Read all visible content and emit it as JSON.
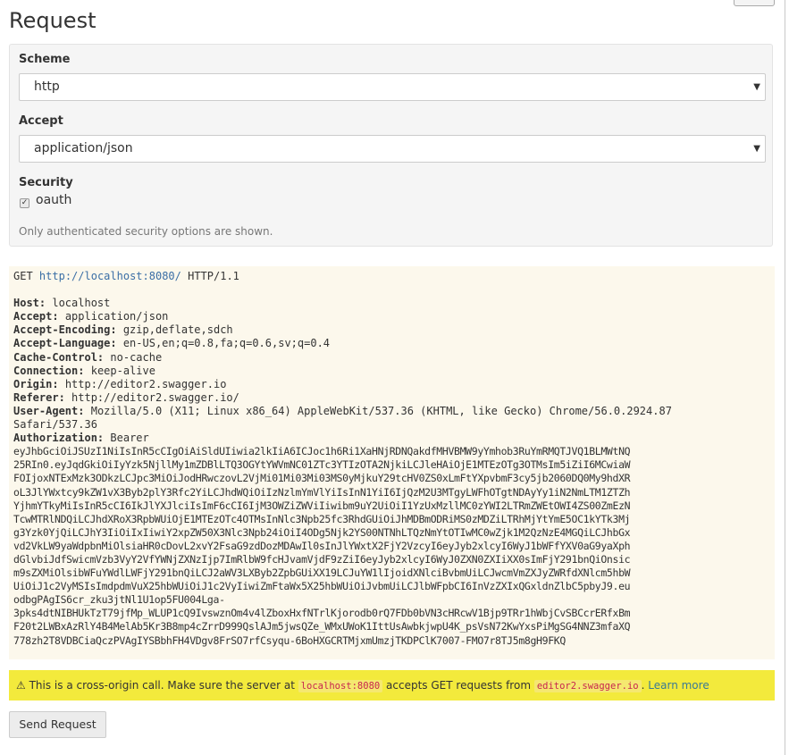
{
  "title": "Request",
  "scheme": {
    "label": "Scheme",
    "value": "http"
  },
  "accept": {
    "label": "Accept",
    "value": "application/json"
  },
  "security": {
    "label": "Security",
    "option": "oauth",
    "checked": true,
    "help": "Only authenticated security options are shown."
  },
  "request": {
    "method": "GET",
    "url": "http://localhost:8080/",
    "protocol": "HTTP/1.1",
    "headers": [
      {
        "name": "Host:",
        "value": "localhost"
      },
      {
        "name": "Accept:",
        "value": "application/json"
      },
      {
        "name": "Accept-Encoding:",
        "value": "gzip,deflate,sdch"
      },
      {
        "name": "Accept-Language:",
        "value": "en-US,en;q=0.8,fa;q=0.6,sv;q=0.4"
      },
      {
        "name": "Cache-Control:",
        "value": "no-cache"
      },
      {
        "name": "Connection:",
        "value": "keep-alive"
      },
      {
        "name": "Origin:",
        "value": "http://editor2.swagger.io"
      },
      {
        "name": "Referer:",
        "value": "http://editor2.swagger.io/"
      }
    ],
    "user_agent_name": "User-Agent:",
    "user_agent_line1": "Mozilla/5.0 (X11; Linux x86_64) AppleWebKit/537.36 (KHTML, like Gecko) Chrome/56.0.2924.87",
    "user_agent_line2": "Safari/537.36",
    "authorization_name": "Authorization:",
    "authorization_value": "Bearer",
    "token_lines": [
      "eyJhbGciOiJSUzI1NiIsInR5cCIgOiAiSldUIiwia2lkIiA6ICJoc1h6Ri1XaHNjRDNQakdfMHVBMW9yYmhob3RuYmRMQTJVQ1BLMWtNQ",
      "25RIn0.eyJqdGkiOiIyYzk5NjllMy1mZDBlLTQ3OGYtYWVmNC01ZTc3YTIzOTA2NjkiLCJleHAiOjE1MTEzOTg3OTMsIm5iZiI6MCwiaW",
      "FOIjoxNTExMzk3ODkzLCJpc3MiOiJodHRwczovL2VjMi01Mi03Mi03MS0yMjkuY29tcHV0ZS0xLmFtYXpvbmF3cy5jb2060DQ0My9hdXR",
      "oL3JlYWxtcy9kZW1vX3Byb2plY3Rfc2YiLCJhdWQiOiIzNzlmYmVlYiIsInN1YiI6IjQzM2U3MTgyLWFhOTgtNDAyYy1iN2NmLTM1ZTZh",
      "YjhmYTkyMiIsInR5cCI6IkJlYXJlciIsImF6cCI6IjM3OWZiZWViIiwibm9uY2UiOiI1YzUxMzllMC0zYWI2LTRmZWEtOWI4ZS00ZmEzN",
      "TcwMTRlNDQiLCJhdXRoX3RpbWUiOjE1MTEzOTc4OTMsInNlc3Npb25fc3RhdGUiOiJhMDBmODRiMS0zMDZiLTRhMjYtYmE5OC1kYTk3Mj",
      "g3Yzk0YjQiLCJhY3IiOiIxIiwiY2xpZW50X3Nlc3Npb24iOiI4ODg5Njk2YS00NTNhLTQzNmYtOTIwMC0wZjk1M2QzNzE4MGQiLCJhbGx",
      "vd2VkLW9yaWdpbnMiOlsiaHR0cDovL2xvY2FsaG9zdDozMDAwIl0sInJlYWxtX2FjY2VzcyI6eyJyb2xlcyI6WyJ1bWFfYXV0aG9yaXph",
      "dGlvbiJdfSwicmVzb3VyY2VfYWNjZXNzIjp7ImRlbW9fcHJvamVjdF9zZiI6eyJyb2xlcyI6WyJ0ZXN0ZXIiXX0sImFjY291bnQiOnsic",
      "m9sZXMiOlsibWFuYWdlLWFjY291bnQiLCJ2aWV3LXByb2ZpbGUiXX19LCJuYW1lIjoidXNlciBvbmUiLCJwcmVmZXJyZWRfdXNlcm5hbW",
      "UiOiJ1c2VyMSIsImdpdmVuX25hbWUiOiJ1c2VyIiwiZmFtaWx5X25hbWUiOiJvbmUiLCJlbWFpbCI6InVzZXIxQGxldnZlbC5pbyJ9.eu",
      "odbgPAgIS6cr_zku3jtNl1U1op5FU004Lga-",
      "3pks4dtNIBHUkTzT79jfMp_WLUP1cQ9IvswznOm4v4lZboxHxfNTrlKjorodb0rQ7FDb0bVN3cHRcwV1Bjp9TRr1hWbjCvSBCcrERfxBm",
      "F20t2LWBxAzRlY4B4MelAb5Kr3B8mp4cZrrD999QslAJm5jwsQZe_WMxUWoK1IttUsAwbkjwpU4K_psVsN72KwYxsPiMgSG4NNZ3mfaXQ",
      "778zh2T8VDBCiaQczPVAgIYSBbhFH4VDgv8FrSO7rfCsyqu-6BoHXGCRTMjxmUmzjTKDPClK7007-FMO7r8TJ5m8gH9FKQ"
    ]
  },
  "warning": {
    "icon": "⚠",
    "prefix": " This is a cross-origin call. Make sure the server at ",
    "server": "localhost:8080",
    "middle": " accepts GET requests from ",
    "origin": "editor2.swagger.io",
    "suffix": ". ",
    "link": "Learn more"
  },
  "send_button": "Send Request"
}
